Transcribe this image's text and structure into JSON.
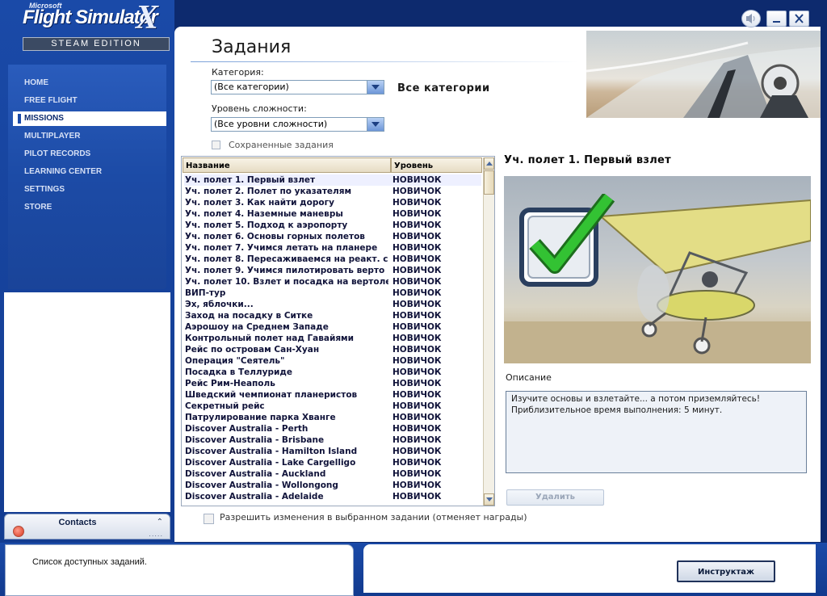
{
  "app": {
    "logo_microsoft": "Microsoft",
    "logo_title": "Flight Simulator",
    "logo_x": "X",
    "logo_edition": "STEAM EDITION"
  },
  "nav": {
    "items": [
      {
        "label": "HOME"
      },
      {
        "label": "FREE FLIGHT"
      },
      {
        "label": "MISSIONS"
      },
      {
        "label": "MULTIPLAYER"
      },
      {
        "label": "PILOT RECORDS"
      },
      {
        "label": "LEARNING CENTER"
      },
      {
        "label": "SETTINGS"
      },
      {
        "label": "STORE"
      }
    ],
    "active": "MISSIONS"
  },
  "contacts": {
    "title": "Contacts",
    "dots": "....."
  },
  "page": {
    "title": "Задания",
    "category_label": "Категория:",
    "category_value": "(Все категории)",
    "category_display": "Все категории",
    "difficulty_label": "Уровень сложности:",
    "difficulty_value": "(Все уровни сложности)",
    "saved_missions_label": "Сохраненные задания",
    "allow_changes_label": "Разрешить изменения в выбранном задании (отменяет награды)"
  },
  "table": {
    "columns": [
      "Название",
      "Уровень"
    ],
    "rows": [
      {
        "name": "Уч. полет 1. Первый взлет",
        "level": "НОВИЧОК"
      },
      {
        "name": "Уч. полет 2. Полет по указателям",
        "level": "НОВИЧОК"
      },
      {
        "name": "Уч. полет 3. Как найти дорогу",
        "level": "НОВИЧОК"
      },
      {
        "name": "Уч. полет 4. Наземные маневры",
        "level": "НОВИЧОК"
      },
      {
        "name": "Уч. полет 5. Подход к аэропорту",
        "level": "НОВИЧОК"
      },
      {
        "name": "Уч. полет 6. Основы горных полетов",
        "level": "НОВИЧОК"
      },
      {
        "name": "Уч. полет 7. Учимся летать на планере",
        "level": "НОВИЧОК"
      },
      {
        "name": "Уч. полет 8. Пересаживаемся на реакт. с",
        "level": "НОВИЧОК"
      },
      {
        "name": "Уч. полет 9. Учимся пилотировать верто",
        "level": "НОВИЧОК"
      },
      {
        "name": "Уч. полет 10. Взлет и посадка на вертоле",
        "level": "НОВИЧОК"
      },
      {
        "name": "ВИП-тур",
        "level": "НОВИЧОК"
      },
      {
        "name": "Эх, яблочки...",
        "level": "НОВИЧОК"
      },
      {
        "name": "Заход на посадку в Ситке",
        "level": "НОВИЧОК"
      },
      {
        "name": "Аэрошоу на Среднем Западе",
        "level": "НОВИЧОК"
      },
      {
        "name": "Контрольный полет над Гавайями",
        "level": "НОВИЧОК"
      },
      {
        "name": "Рейс по островам Сан-Хуан",
        "level": "НОВИЧОК"
      },
      {
        "name": "Операция \"Сеятель\"",
        "level": "НОВИЧОК"
      },
      {
        "name": "Посадка в Теллуриде",
        "level": "НОВИЧОК"
      },
      {
        "name": "Рейс Рим-Неаполь",
        "level": "НОВИЧОК"
      },
      {
        "name": "Шведский чемпионат планеристов",
        "level": "НОВИЧОК"
      },
      {
        "name": "Секретный рейс",
        "level": "НОВИЧОК"
      },
      {
        "name": "Патрулирование парка Хванге",
        "level": "НОВИЧОК"
      },
      {
        "name": "Discover Australia - Perth",
        "level": "НОВИЧОК"
      },
      {
        "name": "Discover Australia - Brisbane",
        "level": "НОВИЧОК"
      },
      {
        "name": "Discover Australia - Hamilton Island",
        "level": "НОВИЧОК"
      },
      {
        "name": "Discover Australia - Lake Cargelligo",
        "level": "НОВИЧОК"
      },
      {
        "name": "Discover Australia - Auckland",
        "level": "НОВИЧОК"
      },
      {
        "name": "Discover Australia - Wollongong",
        "level": "НОВИЧОК"
      },
      {
        "name": "Discover Australia - Adelaide",
        "level": "НОВИЧОК"
      }
    ],
    "selected_index": 0
  },
  "detail": {
    "mission_title": "Уч. полет 1. Первый взлет",
    "description_label": "Описание",
    "description_line1": "Изучите основы и взлетайте... а потом приземляйтесь!",
    "description_line2": "Приблизительное время выполнения: 5 минут.",
    "delete_button": "Удалить"
  },
  "status": {
    "text": "Список доступных заданий."
  },
  "footer": {
    "briefing_button": "Инструктаж"
  },
  "colors": {
    "frame_blue": "#1a4aa8",
    "accent_green": "#2db82d",
    "row_text": "#10133a"
  },
  "icons": [
    "sound-icon",
    "minimize-icon",
    "close-icon",
    "dropdown-arrow-icon",
    "checkmark-icon",
    "status-dot-icon"
  ]
}
